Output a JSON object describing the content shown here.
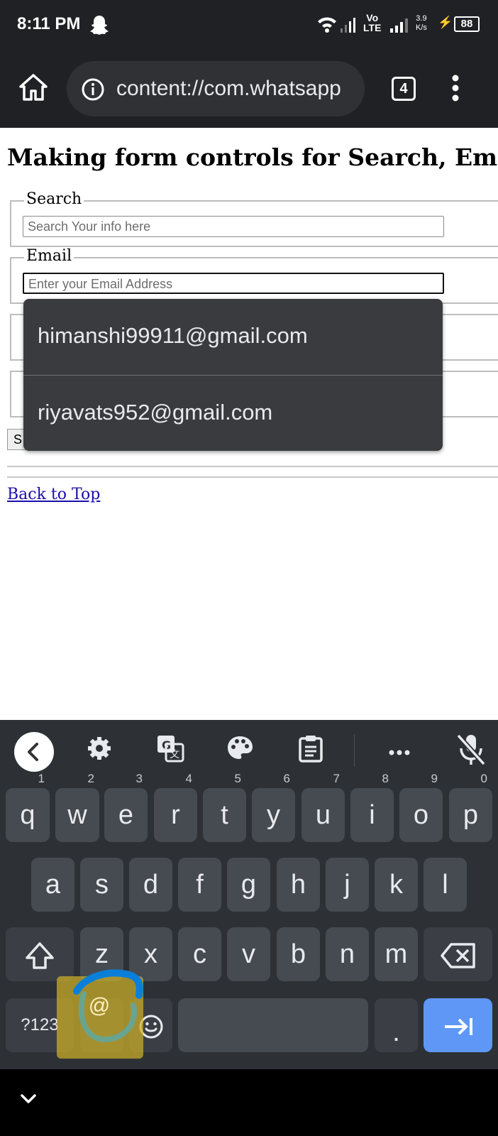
{
  "status_bar": {
    "time": "8:11 PM",
    "volte_top": "Vo",
    "volte_bottom": "LTE",
    "speed_value": "3.9",
    "speed_unit": "K/s",
    "battery": "88",
    "icons": [
      "snapchat-icon",
      "wifi-icon",
      "signal-icon",
      "charging-icon"
    ]
  },
  "browser": {
    "url": "content://com.whatsapp",
    "tab_count": "4",
    "icons": [
      "home-icon",
      "info-icon",
      "more-vert-icon"
    ]
  },
  "page": {
    "heading": "Making form controls for Search, Email,",
    "fieldsets": [
      {
        "legend": "Search",
        "placeholder": "Search Your info here"
      },
      {
        "legend": "Email",
        "placeholder": "Enter your Email Address"
      }
    ],
    "submit_partial": "S",
    "back_to_top": "Back to Top"
  },
  "autofill": {
    "options": [
      "himanshi99911@gmail.com",
      "riyavats952@gmail.com"
    ]
  },
  "keyboard": {
    "toolbar_icons": [
      "back-icon",
      "settings-icon",
      "translate-icon",
      "palette-icon",
      "clipboard-icon",
      "more-icon",
      "mic-off-icon"
    ],
    "row1": [
      {
        "k": "q",
        "h": "1"
      },
      {
        "k": "w",
        "h": "2"
      },
      {
        "k": "e",
        "h": "3"
      },
      {
        "k": "r",
        "h": "4"
      },
      {
        "k": "t",
        "h": "5"
      },
      {
        "k": "y",
        "h": "6"
      },
      {
        "k": "u",
        "h": "7"
      },
      {
        "k": "i",
        "h": "8"
      },
      {
        "k": "o",
        "h": "9"
      },
      {
        "k": "p",
        "h": "0"
      }
    ],
    "row2": [
      "a",
      "s",
      "d",
      "f",
      "g",
      "h",
      "j",
      "k",
      "l"
    ],
    "row3": [
      "z",
      "x",
      "c",
      "v",
      "b",
      "n",
      "m"
    ],
    "symbols_label": "?123",
    "at_label": "@",
    "period_label": ".",
    "highlight_color": "#cfb12a",
    "scribble_color": "#0a7fd9"
  }
}
